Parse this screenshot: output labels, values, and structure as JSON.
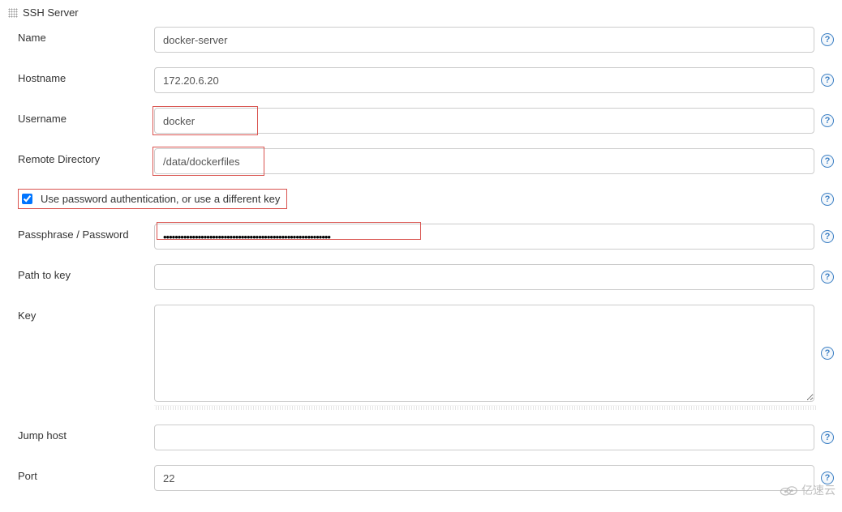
{
  "section": {
    "title": "SSH Server"
  },
  "labels": {
    "name": "Name",
    "hostname": "Hostname",
    "username": "Username",
    "remote_dir": "Remote Directory",
    "use_password": "Use password authentication, or use a different key",
    "passphrase": "Passphrase / Password",
    "path_to_key": "Path to key",
    "key": "Key",
    "jump_host": "Jump host",
    "port": "Port"
  },
  "values": {
    "name": "docker-server",
    "hostname": "172.20.6.20",
    "username": "docker",
    "remote_dir": "/data/dockerfiles",
    "use_password_checked": true,
    "passphrase": "••••••••••••••••••••••••••••••••••••••••••••••••••••••••••",
    "path_to_key": "",
    "key": "",
    "jump_host": "",
    "port": "22"
  },
  "watermark": "亿速云"
}
